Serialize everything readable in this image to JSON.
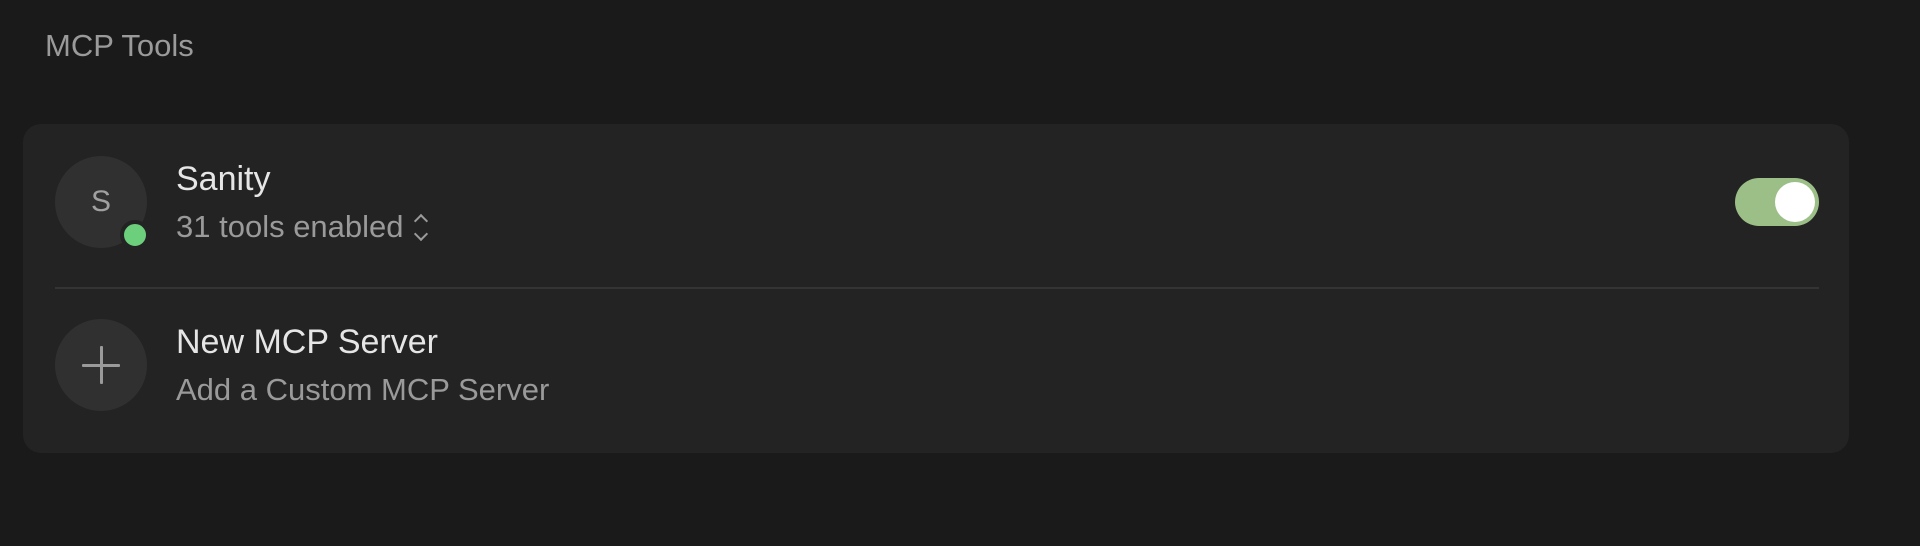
{
  "section": {
    "title": "MCP Tools"
  },
  "servers": [
    {
      "initial": "S",
      "name": "Sanity",
      "status": "connected",
      "status_color": "#6ccf7c",
      "tools_label": "31 tools enabled",
      "enabled": true,
      "toggle_color": "#9cbf88"
    }
  ],
  "new_server": {
    "icon": "plus-icon",
    "title": "New MCP Server",
    "subtitle": "Add a Custom MCP Server"
  },
  "colors": {
    "background": "#1a1a1a",
    "card": "#232323",
    "avatar": "#303030",
    "primary_text": "#e6e6e6",
    "secondary_text": "#9a9a9a"
  }
}
